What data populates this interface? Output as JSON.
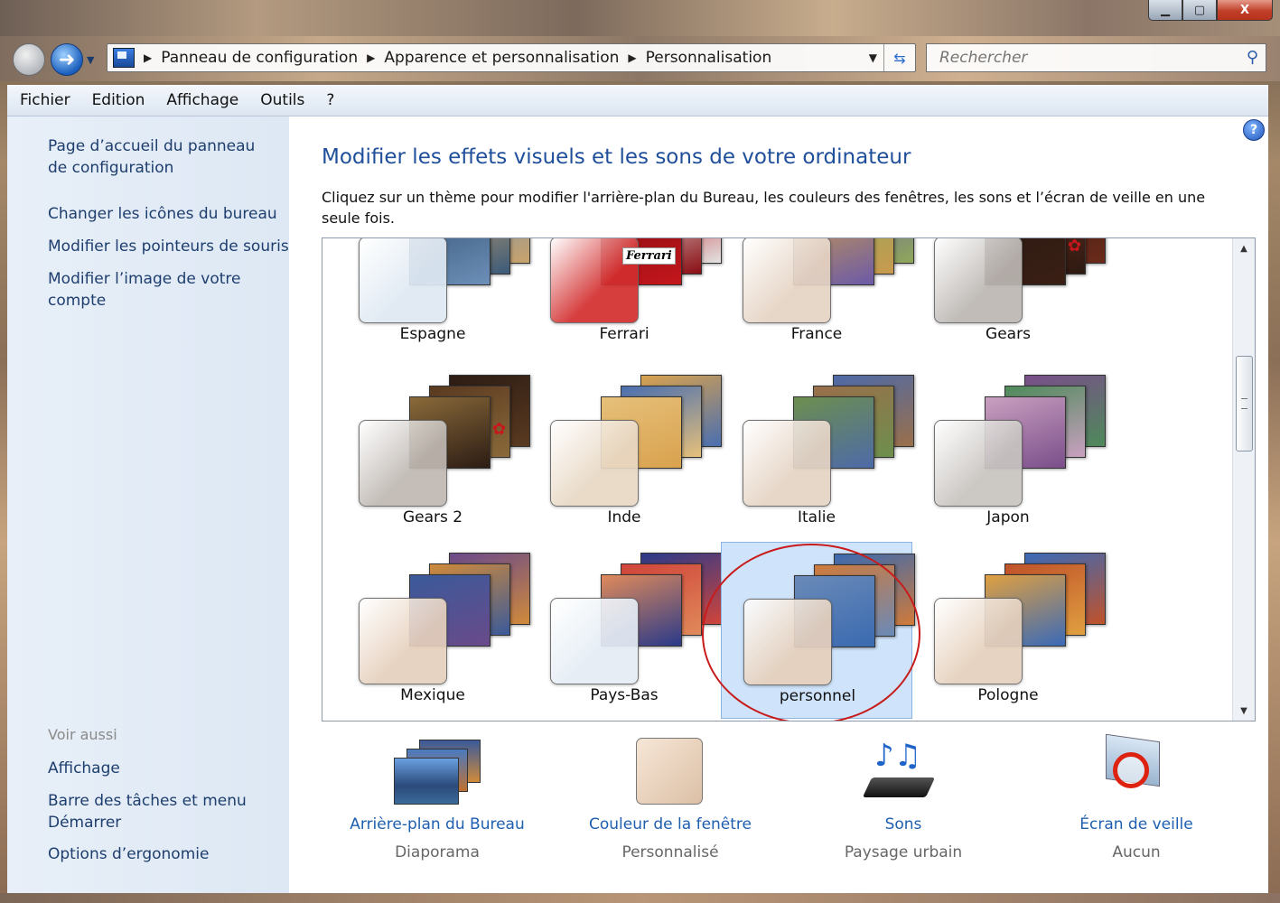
{
  "window": {
    "minimize": "",
    "maximize": "",
    "close": "X"
  },
  "nav": {
    "breadcrumbs": [
      "Panneau de configuration",
      "Apparence et personnalisation",
      "Personnalisation"
    ],
    "search_placeholder": "Rechercher"
  },
  "menu": [
    "Fichier",
    "Edition",
    "Affichage",
    "Outils",
    "?"
  ],
  "sidebar": {
    "links": [
      "Page d’accueil du panneau de configuration",
      "Changer les icônes du bureau",
      "Modifier les pointeurs de souris",
      "Modifier l’image de votre compte"
    ],
    "see_also_heading": "Voir aussi",
    "see_also": [
      "Affichage",
      "Barre des tâches et menu Démarrer",
      "Options d’ergonomie"
    ]
  },
  "main": {
    "heading": "Modifier les effets visuels et les sons de votre ordinateur",
    "description": "Cliquez sur un thème pour modifier l'arrière-plan du Bureau, les couleurs des fenêtres, les sons et l’écran de veille en une seule fois.",
    "help_icon": "?"
  },
  "themes": [
    {
      "name": "Espagne",
      "icon": "theme-espagne-icon",
      "colors": [
        "#6c8fb8",
        "#c9a36a",
        "#3b5a7a"
      ]
    },
    {
      "name": "Ferrari",
      "icon": "theme-ferrari-icon",
      "colors": [
        "#c4161c",
        "#e2e2e2",
        "#8a0d12"
      ],
      "badge": "Ferrari"
    },
    {
      "name": "France",
      "icon": "theme-france-icon",
      "colors": [
        "#6b5aa8",
        "#8fa85a",
        "#c99a4e"
      ]
    },
    {
      "name": "Gears",
      "icon": "theme-gears-icon",
      "colors": [
        "#3a1f14",
        "#6b2a1a",
        "#2b1a12"
      ],
      "badge": "gears"
    },
    {
      "name": "Gears 2",
      "icon": "theme-gears2-icon",
      "colors": [
        "#2c1c14",
        "#5a3a20",
        "#8a6a3a"
      ],
      "badge": "gears"
    },
    {
      "name": "Inde",
      "icon": "theme-inde-icon",
      "colors": [
        "#d9a24e",
        "#4a6fb0",
        "#e6c07a"
      ]
    },
    {
      "name": "Italie",
      "icon": "theme-italie-icon",
      "colors": [
        "#4d6aa8",
        "#9a6f4a",
        "#6d8f4e"
      ]
    },
    {
      "name": "Japon",
      "icon": "theme-japon-icon",
      "colors": [
        "#7a4e8a",
        "#4e8a5a",
        "#c9a0c0"
      ]
    },
    {
      "name": "Mexique",
      "icon": "theme-mexique-icon",
      "colors": [
        "#6a4a8a",
        "#d08a3a",
        "#3a5a9a"
      ]
    },
    {
      "name": "Pays-Bas",
      "icon": "theme-paysbas-icon",
      "colors": [
        "#2a3a8a",
        "#d0443a",
        "#e08a5a"
      ]
    },
    {
      "name": "personnel",
      "icon": "theme-personnel-icon",
      "colors": [
        "#3a6ab0",
        "#d07a3a",
        "#6a8ab8"
      ],
      "selected": true
    },
    {
      "name": "Pologne",
      "icon": "theme-pologne-icon",
      "colors": [
        "#3a6ab8",
        "#c0522a",
        "#e0a040"
      ]
    }
  ],
  "options": [
    {
      "title": "Arrière-plan du Bureau",
      "subtitle": "Diaporama",
      "icon": "desktop-background-icon"
    },
    {
      "title": "Couleur de la fenêtre",
      "subtitle": "Personnalisé",
      "icon": "window-color-icon"
    },
    {
      "title": "Sons",
      "subtitle": "Paysage urbain",
      "icon": "sounds-icon"
    },
    {
      "title": "Écran de veille",
      "subtitle": "Aucun",
      "icon": "screensaver-icon"
    }
  ]
}
